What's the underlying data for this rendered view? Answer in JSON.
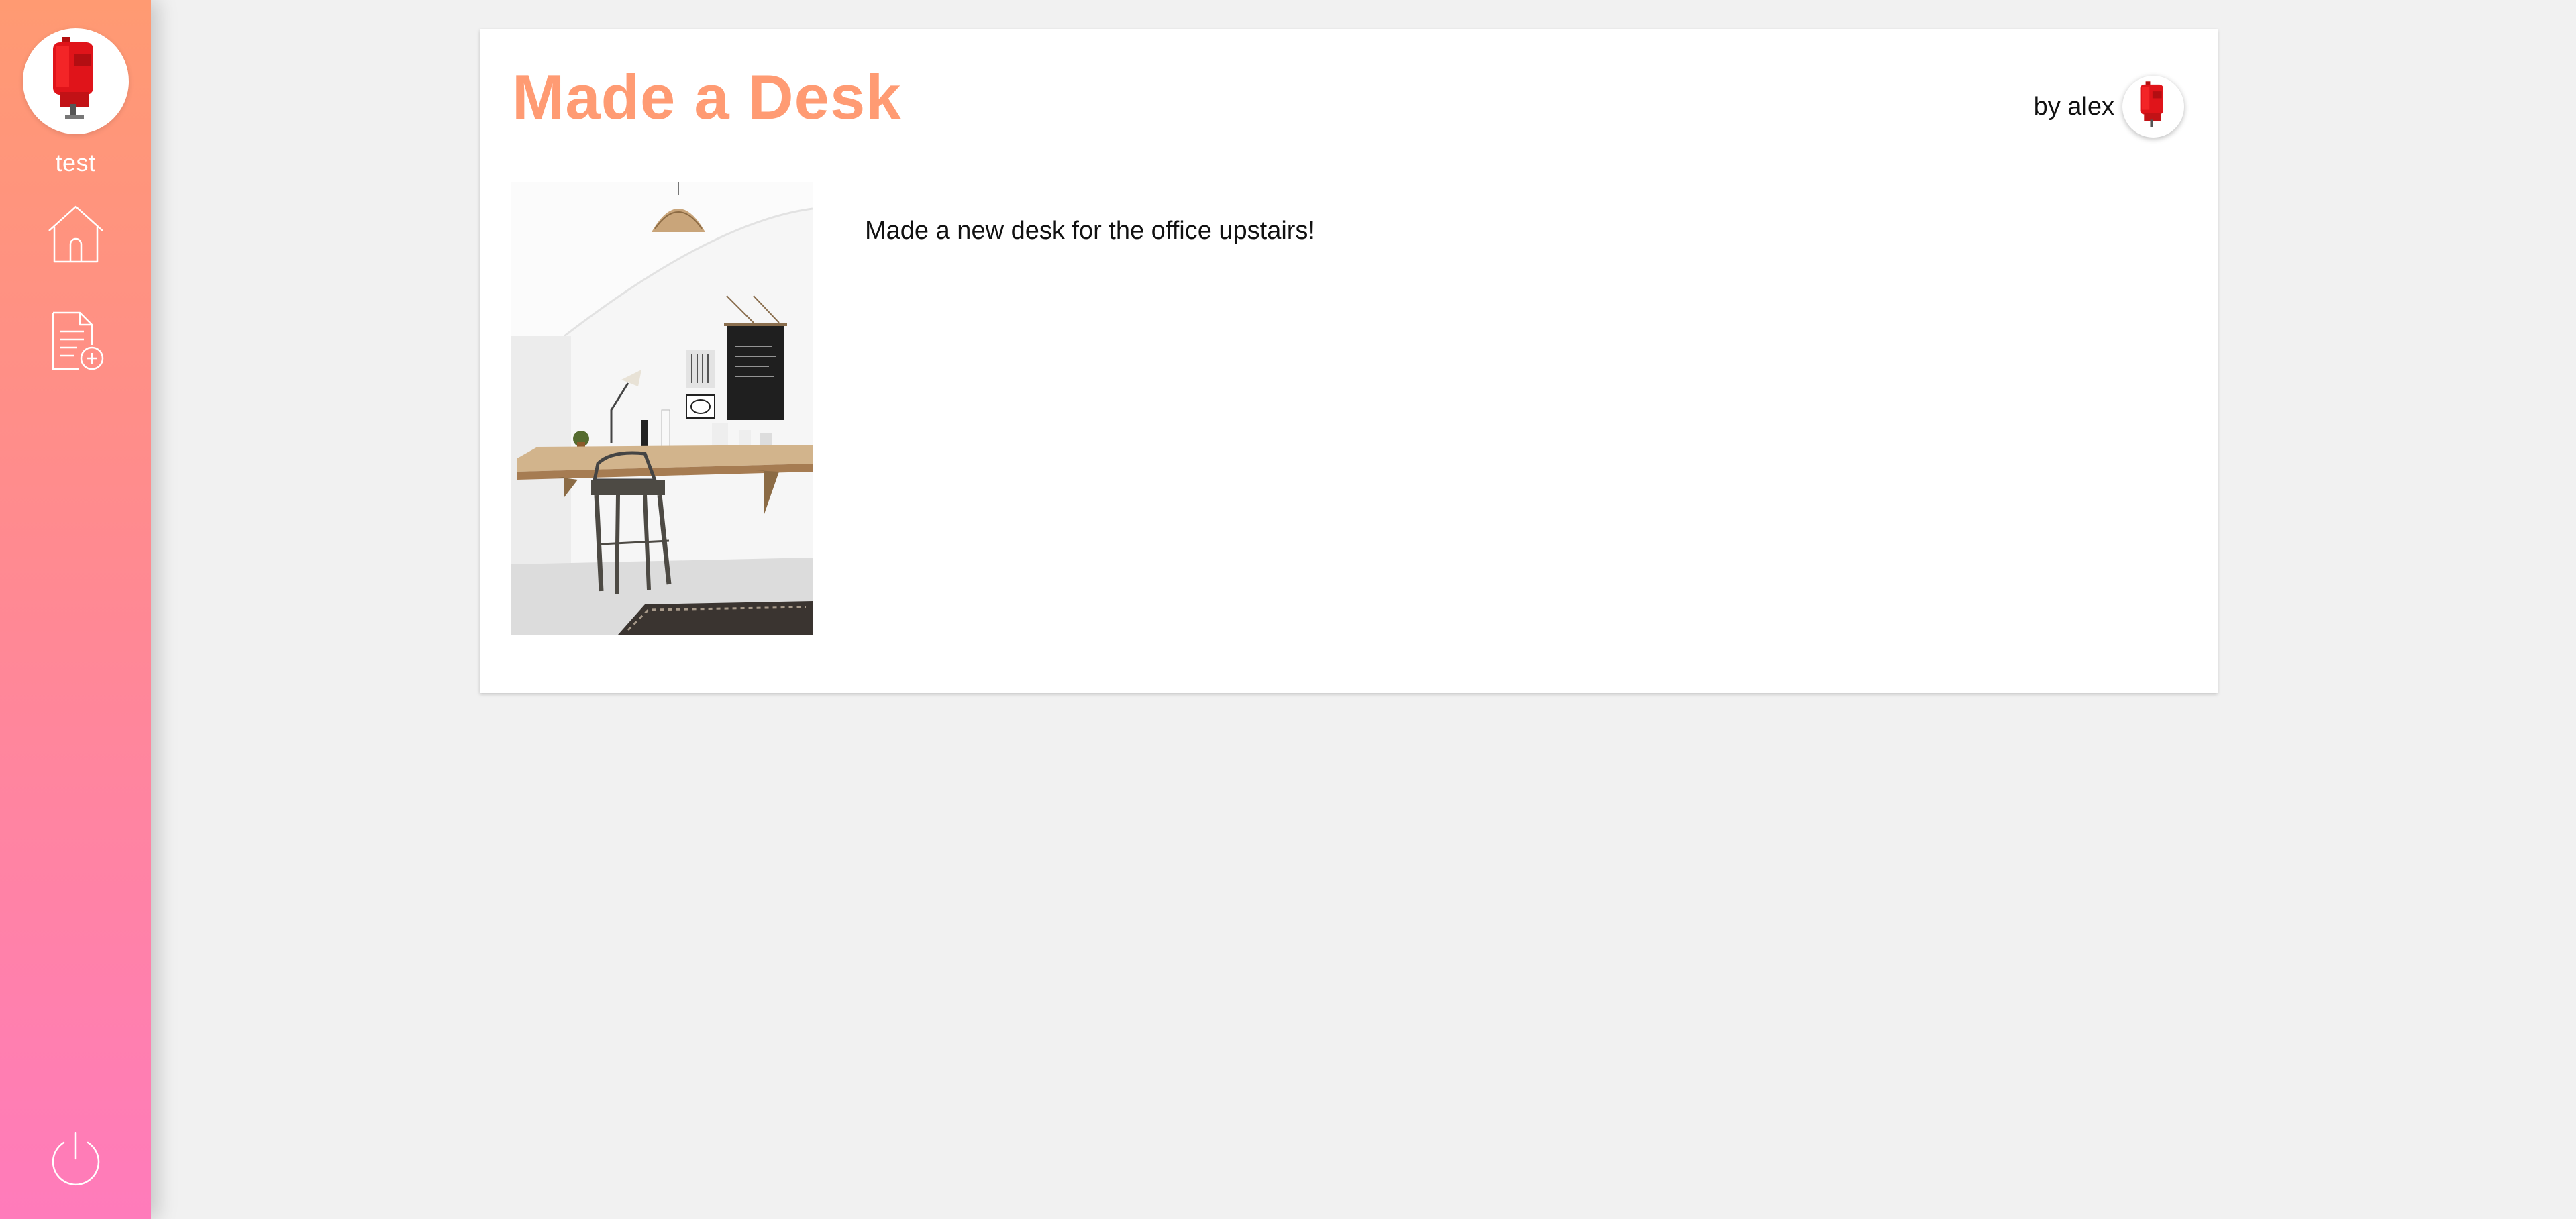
{
  "sidebar": {
    "username": "test",
    "avatar_icon": "robot-avatar-icon",
    "nav": [
      {
        "name": "home",
        "icon": "home-icon"
      },
      {
        "name": "new-post",
        "icon": "new-document-icon"
      }
    ],
    "logout_icon": "power-icon",
    "gradient_top": "#ff9a72",
    "gradient_bottom": "#ff7bbb"
  },
  "post": {
    "title": "Made a Desk",
    "author_label": "by alex",
    "body": "Made a new desk for the office upstairs!",
    "image_icon": "desk-photo"
  },
  "colors": {
    "accent": "#ff9b73",
    "background": "#f1f1f1",
    "card": "#ffffff"
  }
}
